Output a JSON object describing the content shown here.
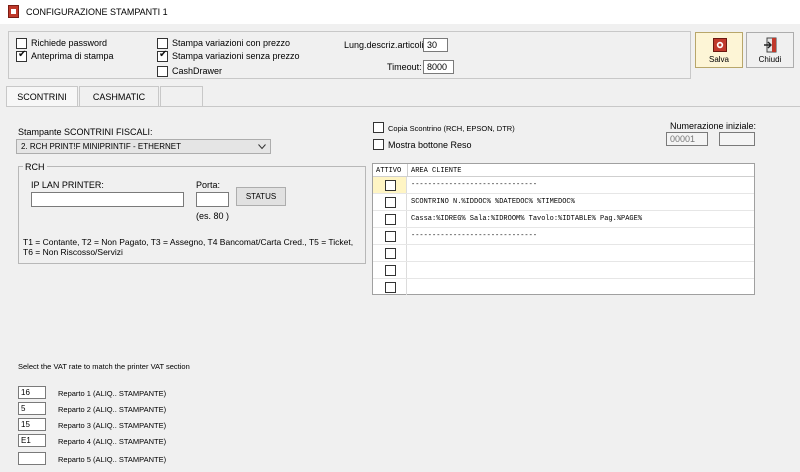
{
  "window": {
    "title": "CONFIGURAZIONE STAMPANTI 1"
  },
  "options": {
    "richiede_password": {
      "label": "Richiede password",
      "checked": false
    },
    "anteprima_stampa": {
      "label": "Anteprima di stampa",
      "checked": true
    },
    "stampa_var_con_prezzo": {
      "label": "Stampa variazioni con prezzo",
      "checked": false
    },
    "stampa_var_senza_prezzo": {
      "label": "Stampa variazioni senza prezzo",
      "checked": true
    },
    "cashdrawer": {
      "label": "CashDrawer",
      "checked": false
    },
    "lung_descr_label": "Lung.descriz.articoli:",
    "lung_descr_value": "30",
    "timeout_label": "Timeout:",
    "timeout_value": "8000"
  },
  "toolbar": {
    "salva_label": "Salva",
    "chiudi_label": "Chiudi",
    "salva_icon": "save-icon",
    "chiudi_icon": "exit-icon"
  },
  "tabs": [
    {
      "label": "SCONTRINI",
      "active": true
    },
    {
      "label": "CASHMATIC",
      "active": false
    }
  ],
  "scontrini": {
    "stampante_label": "Stampante SCONTRINI FISCALI:",
    "stampante_value": "2. RCH PRINT!F MINIPRINTIF - ETHERNET",
    "rch_group_label": "RCH",
    "ip_label": "IP LAN PRINTER:",
    "ip_value": "",
    "porta_label": "Porta:",
    "porta_value": "",
    "porta_hint": "(es.  80 )",
    "status_button": "STATUS",
    "payment_note": "T1 = Contante, T2 = Non Pagato, T3 = Assegno, T4 Bancomat/Carta Cred., T5 = Ticket, T6 = Non Riscosso/Servizi",
    "copia_scontrino": {
      "label": "Copia Scontrino (RCH, EPSON, DTR)",
      "checked": false
    },
    "mostra_reso": {
      "label": "Mostra bottone Reso",
      "checked": false
    },
    "numerazione_label": "Numerazione iniziale:",
    "numerazione_value": "00001",
    "numerazione_value2": ""
  },
  "grid": {
    "col_attivo": "ATTIVO",
    "col_area": "AREA CLIENTE",
    "rows": [
      {
        "checked": false,
        "text": "------------------------------"
      },
      {
        "checked": false,
        "text": "SCONTRINO N.%IDDOC% %DATEDOC% %TIMEDOC%"
      },
      {
        "checked": false,
        "text": "Cassa:%IDREG% Sala:%IDROOM% Tavolo:%IDTABLE% Pag.%PAGE%"
      },
      {
        "checked": false,
        "text": "------------------------------"
      },
      {
        "checked": false,
        "text": ""
      },
      {
        "checked": false,
        "text": ""
      },
      {
        "checked": false,
        "text": ""
      }
    ]
  },
  "vat": {
    "title": "Select the VAT rate to match the printer VAT section",
    "items": [
      {
        "value": "16",
        "label": "Reparto 1 (ALIQ.. STAMPANTE)"
      },
      {
        "value": "5",
        "label": "Reparto 2 (ALIQ.. STAMPANTE)"
      },
      {
        "value": "15",
        "label": "Reparto 3 (ALIQ.. STAMPANTE)"
      },
      {
        "value": "E1",
        "label": "Reparto 4 (ALIQ.. STAMPANTE)"
      },
      {
        "value": "",
        "label": "Reparto 5 (ALIQ.. STAMPANTE)"
      }
    ]
  },
  "colors": {
    "selected_row": "#fff5c4",
    "salva_bg": "#fdf5d6",
    "window_bg": "#f0f0f0"
  }
}
